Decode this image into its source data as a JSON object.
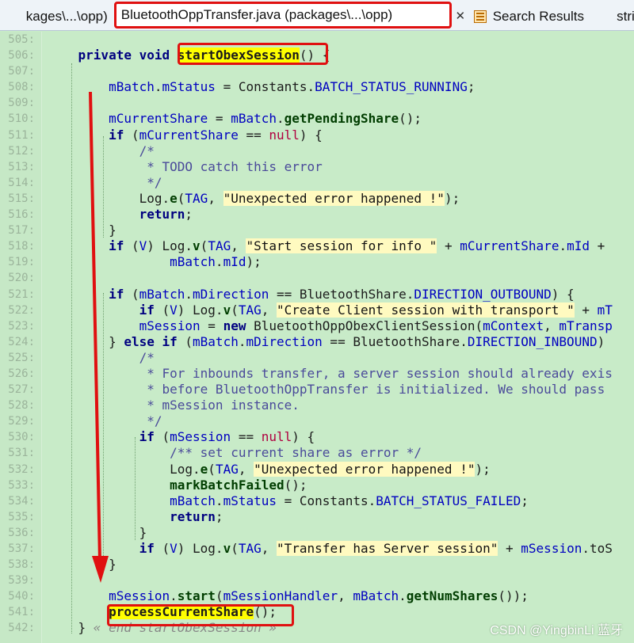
{
  "tabs": [
    {
      "label": "kages\\...\\opp)",
      "active": false
    },
    {
      "label": "BluetoothOppTransfer.java (packages\\...\\opp)",
      "active": true
    },
    {
      "label": "Search Results",
      "active": false
    },
    {
      "label": "strin",
      "active": false
    }
  ],
  "tab_close_glyph": "✕",
  "lines": [
    {
      "n": "505:",
      "code": ""
    },
    {
      "n": "506:",
      "code": "    private void startObexSession() {"
    },
    {
      "n": "507:",
      "code": ""
    },
    {
      "n": "508:",
      "code": "        mBatch.mStatus = Constants.BATCH_STATUS_RUNNING;"
    },
    {
      "n": "509:",
      "code": ""
    },
    {
      "n": "510:",
      "code": "        mCurrentShare = mBatch.getPendingShare();"
    },
    {
      "n": "511:",
      "code": "        if (mCurrentShare == null) {"
    },
    {
      "n": "512:",
      "code": "            /*"
    },
    {
      "n": "513:",
      "code": "             * TODO catch this error"
    },
    {
      "n": "514:",
      "code": "             */"
    },
    {
      "n": "515:",
      "code": "            Log.e(TAG, \"Unexpected error happened !\");"
    },
    {
      "n": "516:",
      "code": "            return;"
    },
    {
      "n": "517:",
      "code": "        }"
    },
    {
      "n": "518:",
      "code": "        if (V) Log.v(TAG, \"Start session for info \" + mCurrentShare.mId +"
    },
    {
      "n": "519:",
      "code": "                mBatch.mId);"
    },
    {
      "n": "520:",
      "code": ""
    },
    {
      "n": "521:",
      "code": "        if (mBatch.mDirection == BluetoothShare.DIRECTION_OUTBOUND) {"
    },
    {
      "n": "522:",
      "code": "            if (V) Log.v(TAG, \"Create Client session with transport \" + mT"
    },
    {
      "n": "523:",
      "code": "            mSession = new BluetoothOppObexClientSession(mContext, mTransp"
    },
    {
      "n": "524:",
      "code": "        } else if (mBatch.mDirection == BluetoothShare.DIRECTION_INBOUND)"
    },
    {
      "n": "525:",
      "code": "            /*"
    },
    {
      "n": "526:",
      "code": "             * For inbounds transfer, a server session should already exis"
    },
    {
      "n": "527:",
      "code": "             * before BluetoothOppTransfer is initialized. We should pass"
    },
    {
      "n": "528:",
      "code": "             * mSession instance."
    },
    {
      "n": "529:",
      "code": "             */"
    },
    {
      "n": "530:",
      "code": "            if (mSession == null) {"
    },
    {
      "n": "531:",
      "code": "                /** set current share as error */"
    },
    {
      "n": "532:",
      "code": "                Log.e(TAG, \"Unexpected error happened !\");"
    },
    {
      "n": "533:",
      "code": "                markBatchFailed();"
    },
    {
      "n": "534:",
      "code": "                mBatch.mStatus = Constants.BATCH_STATUS_FAILED;"
    },
    {
      "n": "535:",
      "code": "                return;"
    },
    {
      "n": "536:",
      "code": "            }"
    },
    {
      "n": "537:",
      "code": "            if (V) Log.v(TAG, \"Transfer has Server session\" + mSession.toS"
    },
    {
      "n": "538:",
      "code": "        }"
    },
    {
      "n": "539:",
      "code": ""
    },
    {
      "n": "540:",
      "code": "        mSession.start(mSessionHandler, mBatch.getNumShares());"
    },
    {
      "n": "541:",
      "code": "        processCurrentShare();"
    },
    {
      "n": "542:",
      "code": "    } « end startObexSession »"
    }
  ],
  "watermark": "CSDN @YingbinLi 蓝牙",
  "colors": {
    "annotation_red": "#e01010",
    "highlight_yellow": "#ffff00",
    "editor_bg": "#c8ebc8"
  }
}
